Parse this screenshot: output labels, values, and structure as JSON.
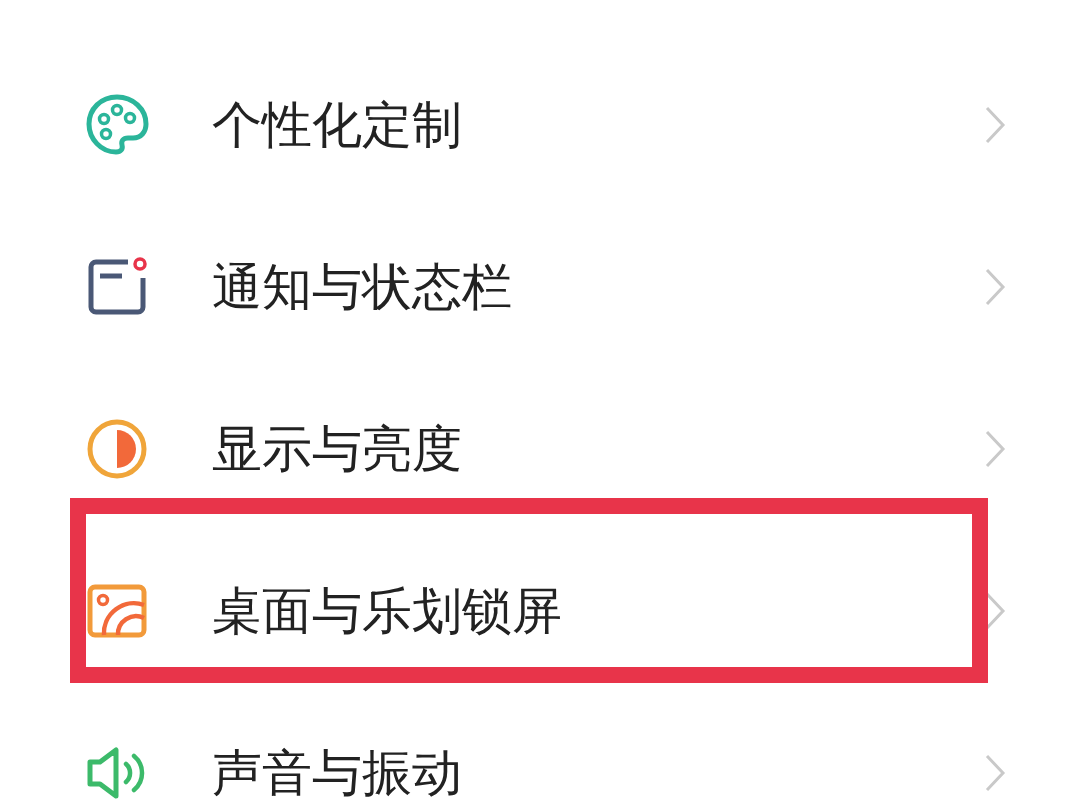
{
  "items": [
    {
      "kind": "palette",
      "label": "个性化定制",
      "highlighted": false
    },
    {
      "kind": "notification",
      "label": "通知与状态栏",
      "highlighted": false
    },
    {
      "kind": "display",
      "label": "显示与亮度",
      "highlighted": false
    },
    {
      "kind": "wallpaper",
      "label": "桌面与乐划锁屏",
      "highlighted": true
    },
    {
      "kind": "sound",
      "label": "声音与振动",
      "highlighted": false
    }
  ]
}
